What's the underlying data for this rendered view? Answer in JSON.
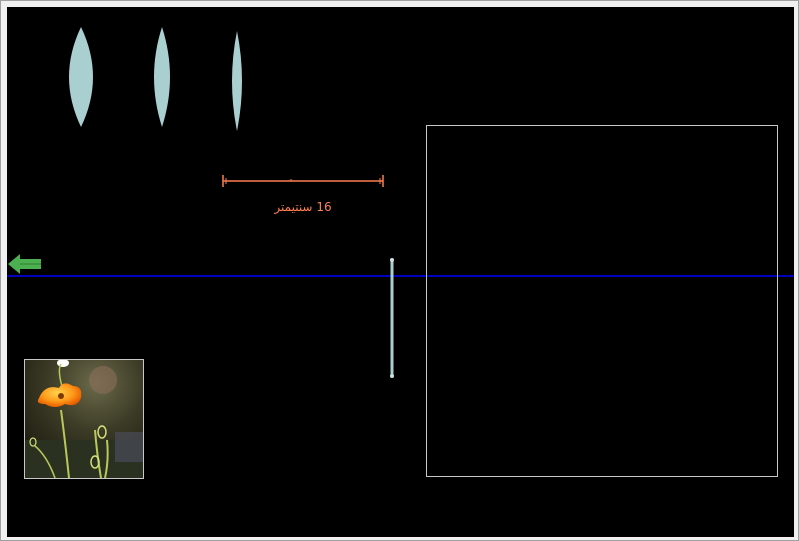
{
  "ruler": {
    "label": "16 سنتیمتر"
  },
  "colors": {
    "canvas_background": "#000000",
    "lens_fill": "#a9cfd1",
    "ruler": "#ff7f50",
    "optical_axis": "#0000ff",
    "arrow": "#4caf50",
    "screen_border": "#c8c8c8"
  },
  "icons": {
    "axis_arrow": "left-arrow-icon",
    "object": "flower-image"
  }
}
